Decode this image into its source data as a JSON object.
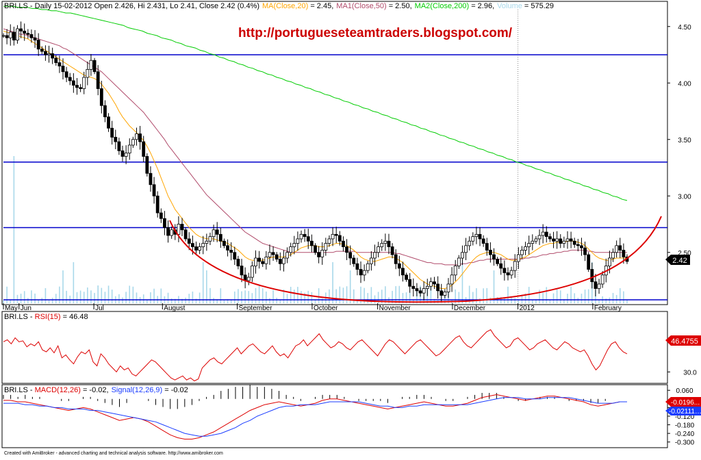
{
  "header": {
    "symbol": "BRI.LS",
    "info": " - Daily 15-02-2012 Open 2.426, Hi 2.431, Lo 2.41, Close 2.42 (0.4%)",
    "ma20_label": "MA(Close,20)",
    "ma20_value": " = 2.45,",
    "ma50_label": "MA1(Close,50)",
    "ma50_value": " = 2.50,",
    "ma200_label": "MA2(Close,200)",
    "ma200_value": " = 2.96,",
    "volume_label": "Volume",
    "volume_value": " = 575.29"
  },
  "watermark": "http://portugueseteamtraders.blogspot.com/",
  "rsi_header": {
    "symbol": "BRI.LS",
    "label": "RSI(15)",
    "value": " = 46.48"
  },
  "macd_header": {
    "symbol": "BRI.LS",
    "macd_label": "MACD(12,26)",
    "macd_value": " = -0.02,",
    "signal_label": "Signal(12,26,9)",
    "signal_value": " = -0.02"
  },
  "price_badge": "2.42",
  "rsi_badge": "46.4755",
  "macd_badge": "-0.0196...",
  "signal_badge": "-0.02111…",
  "footer": "Created with AmiBroker - advanced charting and technical analysis software. http://www.amibroker.com",
  "colors": {
    "price_bars": "#000000",
    "ma20": "#ffa500",
    "ma50": "#b04a6a",
    "ma200": "#00cc00",
    "volume": "#a8d8ea",
    "horizontal_lines": "#0000cc",
    "bowl_curve": "#dd0000",
    "rsi_line": "#dd0000",
    "macd_line": "#dd0000",
    "signal_line": "#1a3cff",
    "watermark": "#cc0000",
    "badge_price_bg": "#000000",
    "badge_rsi_bg": "#dd0000",
    "badge_macd_bg": "#dd0000",
    "badge_signal_bg": "#1a3cff"
  },
  "chart_data": [
    {
      "type": "candlestick",
      "title": "BRI.LS - Daily",
      "y_ticks": [
        "4.50",
        "4.00",
        "3.50",
        "3.00",
        "2.50"
      ],
      "ylim": [
        2.05,
        4.65
      ],
      "x_ticks": [
        "May",
        "Jun",
        "Jul",
        "August",
        "September",
        "October",
        "November",
        "December",
        "2012",
        "February"
      ],
      "horizontal_levels": [
        4.25,
        3.3,
        2.72,
        2.08
      ],
      "closes": [
        4.42,
        4.4,
        4.45,
        4.38,
        4.48,
        4.46,
        4.44,
        4.43,
        4.4,
        4.38,
        4.3,
        4.28,
        4.25,
        4.26,
        4.22,
        4.18,
        4.15,
        4.1,
        4.05,
        4.02,
        3.98,
        3.96,
        3.95,
        4.05,
        4.12,
        4.2,
        4.1,
        3.95,
        3.8,
        3.7,
        3.6,
        3.52,
        3.48,
        3.4,
        3.35,
        3.38,
        3.45,
        3.5,
        3.55,
        3.48,
        3.35,
        3.2,
        3.1,
        3.0,
        2.85,
        2.8,
        2.72,
        2.65,
        2.7,
        2.66,
        2.75,
        2.7,
        2.62,
        2.58,
        2.55,
        2.52,
        2.55,
        2.58,
        2.6,
        2.64,
        2.7,
        2.66,
        2.6,
        2.56,
        2.52,
        2.5,
        2.44,
        2.38,
        2.3,
        2.25,
        2.28,
        2.38,
        2.45,
        2.42,
        2.4,
        2.46,
        2.5,
        2.48,
        2.44,
        2.4,
        2.45,
        2.5,
        2.55,
        2.58,
        2.62,
        2.66,
        2.64,
        2.6,
        2.56,
        2.5,
        2.46,
        2.52,
        2.58,
        2.62,
        2.66,
        2.65,
        2.6,
        2.55,
        2.5,
        2.45,
        2.4,
        2.35,
        2.3,
        2.34,
        2.4,
        2.45,
        2.5,
        2.55,
        2.58,
        2.6,
        2.55,
        2.48,
        2.4,
        2.36,
        2.3,
        2.26,
        2.2,
        2.18,
        2.16,
        2.14,
        2.18,
        2.2,
        2.24,
        2.22,
        2.16,
        2.12,
        2.15,
        2.22,
        2.3,
        2.38,
        2.45,
        2.5,
        2.56,
        2.6,
        2.64,
        2.66,
        2.62,
        2.58,
        2.52,
        2.48,
        2.44,
        2.4,
        2.36,
        2.32,
        2.3,
        2.34,
        2.42,
        2.48,
        2.52,
        2.55,
        2.58,
        2.6,
        2.62,
        2.65,
        2.68,
        2.64,
        2.62,
        2.6,
        2.62,
        2.58,
        2.6,
        2.62,
        2.6,
        2.57,
        2.56,
        2.54,
        2.48,
        2.35,
        2.24,
        2.18,
        2.22,
        2.3,
        2.38,
        2.45,
        2.5,
        2.56,
        2.52,
        2.46,
        2.42
      ],
      "ma20": [
        4.46,
        4.45,
        4.44,
        4.43,
        4.42,
        4.41,
        4.4,
        4.39,
        4.37,
        4.35,
        4.33,
        4.31,
        4.29,
        4.27,
        4.25,
        4.23,
        4.21,
        4.19,
        4.17,
        4.15,
        4.13,
        4.11,
        4.09,
        4.07,
        4.06,
        4.05,
        4.04,
        4.02,
        3.99,
        3.95,
        3.91,
        3.86,
        3.81,
        3.75,
        3.7,
        3.66,
        3.62,
        3.59,
        3.56,
        3.53,
        3.49,
        3.44,
        3.38,
        3.31,
        3.24,
        3.16,
        3.08,
        3.0,
        2.94,
        2.88,
        2.84,
        2.8,
        2.76,
        2.72,
        2.69,
        2.66,
        2.64,
        2.63,
        2.62,
        2.62,
        2.62,
        2.61,
        2.6,
        2.59,
        2.58,
        2.56,
        2.54,
        2.52,
        2.49,
        2.46,
        2.44,
        2.43,
        2.43,
        2.43,
        2.43,
        2.44,
        2.45,
        2.46,
        2.46,
        2.46,
        2.46,
        2.47,
        2.48,
        2.5,
        2.52,
        2.54,
        2.55,
        2.56,
        2.56,
        2.56,
        2.55,
        2.55,
        2.55,
        2.56,
        2.57,
        2.58,
        2.58,
        2.57,
        2.56,
        2.54,
        2.52,
        2.49,
        2.46,
        2.44,
        2.43,
        2.42,
        2.42,
        2.43,
        2.44,
        2.45,
        2.46,
        2.46,
        2.45,
        2.43,
        2.41,
        2.38,
        2.35,
        2.32,
        2.29,
        2.26,
        2.24,
        2.22,
        2.21,
        2.2,
        2.19,
        2.18,
        2.18,
        2.19,
        2.21,
        2.24,
        2.27,
        2.31,
        2.35,
        2.39,
        2.43,
        2.46,
        2.48,
        2.49,
        2.5,
        2.5,
        2.5,
        2.49,
        2.48,
        2.46,
        2.44,
        2.43,
        2.43,
        2.44,
        2.45,
        2.46,
        2.48,
        2.5,
        2.52,
        2.54,
        2.56,
        2.57,
        2.58,
        2.58,
        2.59,
        2.59,
        2.59,
        2.6,
        2.6,
        2.6,
        2.59,
        2.58,
        2.56,
        2.53,
        2.5,
        2.47,
        2.45,
        2.44,
        2.43,
        2.43,
        2.44,
        2.45,
        2.45,
        2.45,
        2.45
      ],
      "ma50": [
        4.48,
        4.47,
        4.46,
        4.45,
        4.44,
        4.43,
        4.43,
        4.42,
        4.41,
        4.4,
        4.39,
        4.38,
        4.37,
        4.36,
        4.35,
        4.34,
        4.33,
        4.31,
        4.3,
        4.28,
        4.26,
        4.24,
        4.22,
        4.2,
        4.18,
        4.16,
        4.14,
        4.12,
        4.1,
        4.07,
        4.04,
        4.01,
        3.98,
        3.95,
        3.92,
        3.89,
        3.86,
        3.83,
        3.8,
        3.77,
        3.74,
        3.7,
        3.66,
        3.62,
        3.58,
        3.54,
        3.5,
        3.45,
        3.41,
        3.37,
        3.33,
        3.29,
        3.25,
        3.21,
        3.17,
        3.13,
        3.09,
        3.05,
        3.01,
        2.98,
        2.95,
        2.92,
        2.89,
        2.86,
        2.83,
        2.8,
        2.77,
        2.74,
        2.71,
        2.68,
        2.66,
        2.64,
        2.62,
        2.6,
        2.58,
        2.57,
        2.56,
        2.55,
        2.54,
        2.53,
        2.52,
        2.51,
        2.5,
        2.5,
        2.5,
        2.5,
        2.5,
        2.5,
        2.5,
        2.5,
        2.5,
        2.5,
        2.5,
        2.5,
        2.5,
        2.51,
        2.51,
        2.51,
        2.51,
        2.51,
        2.51,
        2.5,
        2.5,
        2.5,
        2.5,
        2.5,
        2.5,
        2.5,
        2.5,
        2.5,
        2.5,
        2.5,
        2.49,
        2.49,
        2.48,
        2.47,
        2.46,
        2.45,
        2.44,
        2.43,
        2.42,
        2.41,
        2.41,
        2.4,
        2.4,
        2.4,
        2.39,
        2.39,
        2.39,
        2.39,
        2.39,
        2.4,
        2.4,
        2.41,
        2.41,
        2.42,
        2.43,
        2.43,
        2.44,
        2.44,
        2.44,
        2.44,
        2.44,
        2.44,
        2.44,
        2.44,
        2.44,
        2.44,
        2.44,
        2.45,
        2.45,
        2.46,
        2.46,
        2.47,
        2.48,
        2.48,
        2.49,
        2.49,
        2.5,
        2.5,
        2.51,
        2.51,
        2.52,
        2.52,
        2.52,
        2.52,
        2.52,
        2.51,
        2.51,
        2.5,
        2.5,
        2.5,
        2.5,
        2.5,
        2.5,
        2.5,
        2.5,
        2.5,
        2.5
      ],
      "ma200": [
        4.68,
        4.68,
        4.68,
        4.67,
        4.67,
        4.67,
        4.66,
        4.66,
        4.65,
        4.65,
        4.64,
        4.64,
        4.63,
        4.62,
        4.62,
        4.61,
        4.6,
        4.59,
        4.58,
        4.57,
        4.56,
        4.55,
        4.54,
        4.53,
        4.52,
        4.51,
        4.49,
        4.48,
        4.47,
        4.46,
        4.44,
        4.43,
        4.42,
        4.4,
        4.39,
        4.38,
        4.36,
        4.35,
        4.33,
        4.32,
        4.31,
        4.29,
        4.28,
        4.26,
        4.25,
        4.23,
        4.22,
        4.2,
        4.19,
        4.17,
        4.16,
        4.14,
        4.13,
        4.11,
        4.1,
        4.08,
        4.07,
        4.05,
        4.04,
        4.02,
        4.01,
        3.99,
        3.98,
        3.96,
        3.95,
        3.93,
        3.92,
        3.9,
        3.89,
        3.87,
        3.86,
        3.84,
        3.83,
        3.81,
        3.8,
        3.78,
        3.77,
        3.75,
        3.74,
        3.72,
        3.71,
        3.69,
        3.68,
        3.66,
        3.65,
        3.63,
        3.62,
        3.6,
        3.59,
        3.57,
        3.56,
        3.54,
        3.53,
        3.51,
        3.5,
        3.48,
        3.47,
        3.45,
        3.44,
        3.42,
        3.41,
        3.39,
        3.38,
        3.36,
        3.35,
        3.33,
        3.32,
        3.3,
        3.29,
        3.27,
        3.26,
        3.24,
        3.23,
        3.21,
        3.2,
        3.18,
        3.17,
        3.15,
        3.14,
        3.12,
        3.11,
        3.09,
        3.08,
        3.06,
        3.05,
        3.03,
        3.02,
        3.0,
        2.99,
        2.97,
        2.96
      ]
    },
    {
      "type": "line",
      "title": "RSI(15)",
      "y_ticks": [
        "30.0"
      ],
      "ylim": [
        20,
        80
      ],
      "series": [
        {
          "name": "RSI(15)",
          "values": [
            60,
            62,
            58,
            64,
            60,
            61,
            55,
            58,
            56,
            60,
            52,
            50,
            54,
            49,
            56,
            44,
            47,
            42,
            38,
            45,
            50,
            48,
            52,
            40,
            36,
            48,
            44,
            38,
            34,
            30,
            36,
            32,
            34,
            28,
            26,
            30,
            34,
            38,
            42,
            40,
            36,
            32,
            28,
            24,
            22,
            24,
            26,
            22,
            24,
            21,
            23,
            34,
            38,
            42,
            44,
            40,
            38,
            42,
            46,
            50,
            54,
            48,
            52,
            56,
            58,
            54,
            50,
            48,
            52,
            56,
            50,
            46,
            48,
            44,
            50,
            56,
            58,
            62,
            56,
            60,
            64,
            68,
            62,
            58,
            54,
            56,
            60,
            58,
            54,
            52,
            56,
            60,
            62,
            58,
            54,
            50,
            46,
            52,
            58,
            62,
            60,
            56,
            52,
            48,
            52,
            56,
            60,
            62,
            58,
            54,
            50,
            46,
            48,
            52,
            56,
            60,
            64,
            66,
            60,
            56,
            54,
            58,
            62,
            66,
            70,
            72,
            66,
            62,
            58,
            54,
            56,
            62,
            64,
            60,
            56,
            52,
            54,
            58,
            60,
            62,
            58,
            54,
            52,
            56,
            60,
            58,
            54,
            52,
            50,
            52,
            46,
            38,
            32,
            36,
            44,
            52,
            58,
            60,
            54,
            50,
            48
          ]
        }
      ]
    },
    {
      "type": "line",
      "title": "MACD(12,26) / Signal(12,26,9)",
      "y_ticks": [
        "0.060",
        "-0.060",
        "-0.120",
        "-0.180",
        "-0.240",
        "-0.300"
      ],
      "ylim": [
        -0.33,
        0.08
      ],
      "series": [
        {
          "name": "MACD(12,26)",
          "values": [
            -0.01,
            -0.01,
            -0.02,
            -0.02,
            -0.03,
            -0.04,
            -0.05,
            -0.06,
            -0.07,
            -0.08,
            -0.07,
            -0.06,
            -0.07,
            -0.09,
            -0.11,
            -0.13,
            -0.15,
            -0.14,
            -0.13,
            -0.14,
            -0.16,
            -0.19,
            -0.22,
            -0.25,
            -0.27,
            -0.28,
            -0.28,
            -0.27,
            -0.25,
            -0.23,
            -0.2,
            -0.17,
            -0.14,
            -0.11,
            -0.08,
            -0.06,
            -0.04,
            -0.03,
            -0.02,
            -0.03,
            -0.04,
            -0.05,
            -0.04,
            -0.03,
            -0.01,
            0.0,
            0.0,
            -0.01,
            -0.02,
            -0.03,
            -0.04,
            -0.05,
            -0.06,
            -0.07,
            -0.06,
            -0.05,
            -0.04,
            -0.03,
            -0.02,
            -0.03,
            -0.04,
            -0.05,
            -0.05,
            -0.04,
            -0.03,
            -0.01,
            0.01,
            0.02,
            0.03,
            0.02,
            0.01,
            0.0,
            -0.01,
            0.0,
            0.01,
            0.02,
            0.02,
            0.01,
            0.0,
            -0.01,
            -0.02,
            -0.04,
            -0.05,
            -0.04,
            -0.03,
            -0.02,
            -0.02
          ]
        },
        {
          "name": "Signal(12,26,9)",
          "values": [
            -0.03,
            -0.03,
            -0.03,
            -0.04,
            -0.04,
            -0.05,
            -0.05,
            -0.06,
            -0.06,
            -0.07,
            -0.07,
            -0.07,
            -0.08,
            -0.08,
            -0.09,
            -0.1,
            -0.11,
            -0.12,
            -0.13,
            -0.14,
            -0.15,
            -0.16,
            -0.18,
            -0.2,
            -0.22,
            -0.24,
            -0.25,
            -0.26,
            -0.26,
            -0.25,
            -0.24,
            -0.22,
            -0.2,
            -0.17,
            -0.15,
            -0.12,
            -0.1,
            -0.08,
            -0.06,
            -0.05,
            -0.05,
            -0.04,
            -0.04,
            -0.04,
            -0.03,
            -0.02,
            -0.02,
            -0.02,
            -0.02,
            -0.02,
            -0.03,
            -0.04,
            -0.05,
            -0.05,
            -0.06,
            -0.06,
            -0.05,
            -0.05,
            -0.04,
            -0.04,
            -0.04,
            -0.04,
            -0.04,
            -0.04,
            -0.04,
            -0.03,
            -0.02,
            -0.01,
            0.0,
            0.01,
            0.01,
            0.01,
            0.0,
            0.0,
            0.0,
            0.01,
            0.01,
            0.01,
            0.01,
            0.0,
            -0.01,
            -0.02,
            -0.03,
            -0.03,
            -0.03,
            -0.02,
            -0.02
          ]
        }
      ]
    }
  ]
}
